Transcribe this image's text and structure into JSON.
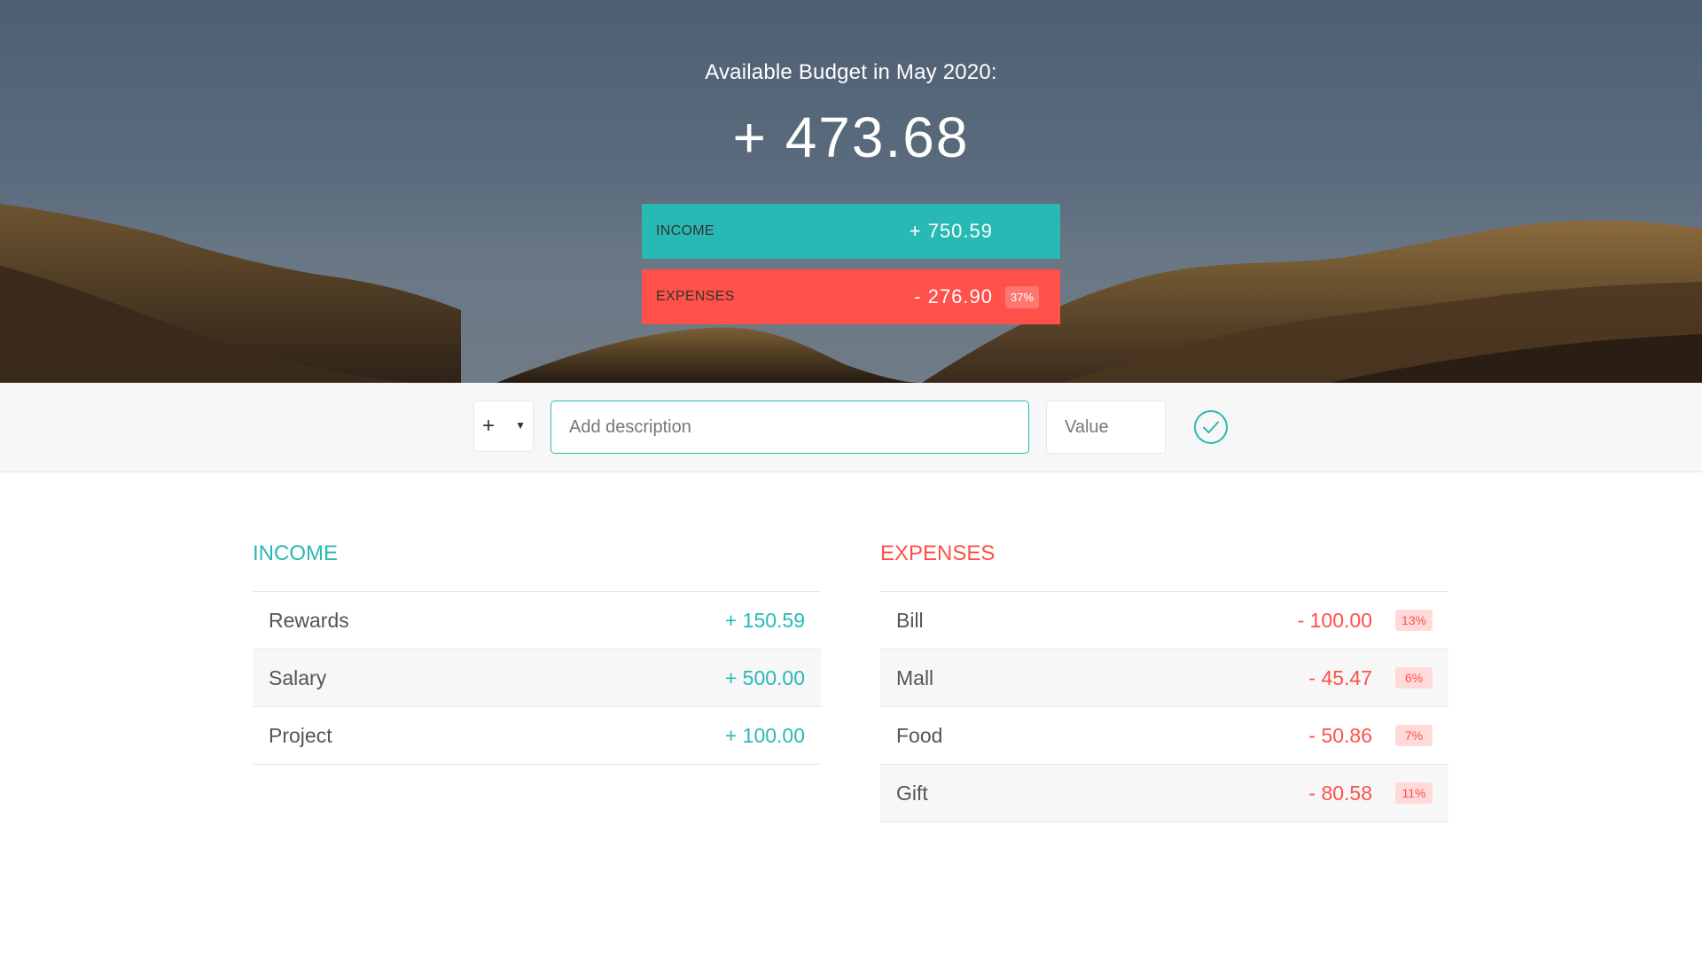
{
  "header": {
    "title": "Available Budget in May 2020:",
    "budget": "+ 473.68"
  },
  "summary": {
    "income_label": "Income",
    "income_value": "+ 750.59",
    "expenses_label": "Expenses",
    "expenses_value": "- 276.90",
    "expenses_percent": "37%"
  },
  "add_form": {
    "type_value": "+",
    "description_placeholder": "Add description",
    "value_placeholder": "Value",
    "submit_icon": "check-circle-icon"
  },
  "income": {
    "title": "Income",
    "items": [
      {
        "description": "Rewards",
        "value": "+ 150.59"
      },
      {
        "description": "Salary",
        "value": "+ 500.00"
      },
      {
        "description": "Project",
        "value": "+ 100.00"
      }
    ]
  },
  "expenses": {
    "title": "Expenses",
    "items": [
      {
        "description": "Bill",
        "value": "- 100.00",
        "percent": "13%"
      },
      {
        "description": "Mall",
        "value": "- 45.47",
        "percent": "6%"
      },
      {
        "description": "Food",
        "value": "- 50.86",
        "percent": "7%"
      },
      {
        "description": "Gift",
        "value": "- 80.58",
        "percent": "11%"
      }
    ]
  },
  "colors": {
    "income": "#28b9b5",
    "expenses": "#ff5049",
    "background": "#f7f7f7"
  }
}
